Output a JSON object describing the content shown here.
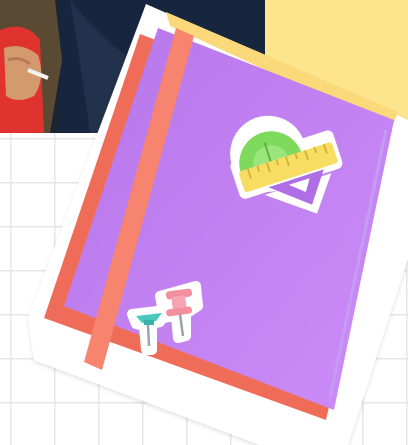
{
  "scene": {
    "background": "white-grid-paper",
    "photo": "child-sitting-on-lap",
    "sticky_note": "yellow-sticky-note",
    "notebook": "purple-notebook-sticker",
    "stickers": [
      "geometry-set-sticker",
      "pushpin-sticker"
    ]
  },
  "colors": {
    "grid_line": "#e6e6e6",
    "sticky_note": "#fde58e",
    "notebook_cover": "#b776ea",
    "notebook_cover_highlight": "#cc8cf8",
    "notebook_back": "#ef6c58",
    "notebook_pages": "#fbd97a",
    "elastic_band": "#f6846f",
    "protractor": "#7fd95c",
    "ruler": "#f7dd62",
    "set_square": "#b06ee6",
    "pin_red": "#f38f9d",
    "pin_teal": "#48c9bc"
  }
}
